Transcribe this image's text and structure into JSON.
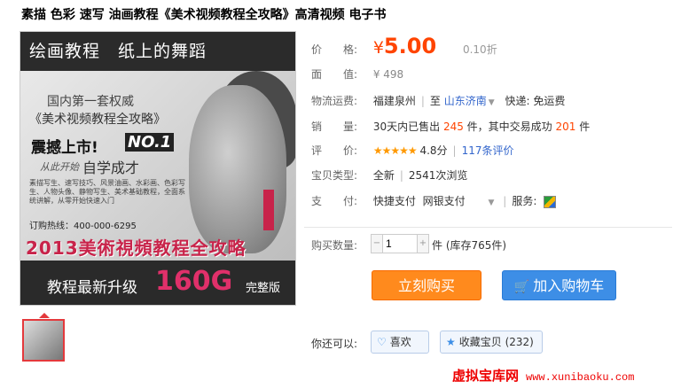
{
  "title": "素描 色彩 速写 油画教程《美术视频教程全攻略》高清视频 电子书",
  "image": {
    "banner_top": "绘画教程　纸上的舞蹈",
    "line1": "国内第一套权威",
    "line2": "《美术视频教程全攻略》",
    "line3": "震撼上市!",
    "line3b": "NO.1",
    "line4": "从此开始",
    "line5": "自学成才",
    "line6": "素描写生、速写技巧、风景油画、水彩画、色彩写生、人物头像、静物写生、美术基础教程，全面系统讲解，从零开始快速入门",
    "phone": "订购热线：400-000-6295",
    "headline": "2013美術視頻教程全攻略",
    "bottom_left": "教程最新升级",
    "bottom_size": "160G",
    "bottom_right": "完整版"
  },
  "price": {
    "label": "价　　格:",
    "currency": "¥",
    "value": "5.00",
    "discount": "0.10折"
  },
  "face_value": {
    "label": "面　　值:",
    "value": "¥ 498"
  },
  "shipping": {
    "label": "物流运费:",
    "from": "福建泉州",
    "to_word": "至",
    "to": "山东济南",
    "fee": "快递: 免运费"
  },
  "sales": {
    "label": "销　　量:",
    "prefix": "30天内已售出",
    "sold": "245",
    "mid": "件，其中交易成功",
    "success": "201",
    "suffix": "件"
  },
  "rating": {
    "label": "评　　价:",
    "stars": "★★★★★",
    "score": "4.8分",
    "reviews": "117条评价"
  },
  "type": {
    "label": "宝贝类型:",
    "value": "全新",
    "views": "2541次浏览"
  },
  "payment": {
    "label": "支　　付:",
    "opt1": "快捷支付",
    "opt2": "网银支付",
    "service_label": "服务:"
  },
  "quantity": {
    "label": "购买数量:",
    "value": "1",
    "unit": "件 (库存765件)"
  },
  "buttons": {
    "buy": "立刻购买",
    "cart": "加入购物车"
  },
  "extras": {
    "label": "你还可以:",
    "like": "喜欢",
    "favorite": "收藏宝贝 (232)"
  },
  "watermark": {
    "cn": "虚拟宝库网",
    "url": "www.xunibaoku.com"
  },
  "colors": {
    "accent": "#ff4400",
    "buy": "#ff8a1d",
    "cart": "#3d8ee6",
    "brand_pink": "#c8234a"
  }
}
